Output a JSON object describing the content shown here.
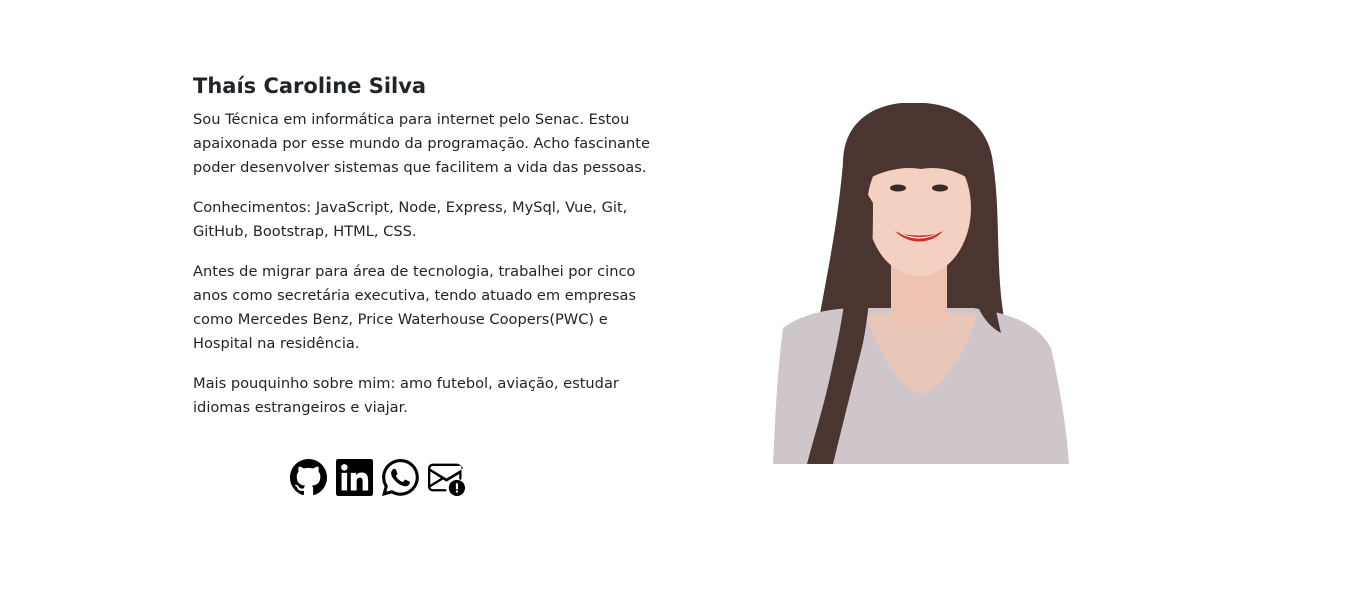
{
  "profile": {
    "name": "Thaís Caroline Silva",
    "paragraphs": [
      "Sou Técnica em informática para internet pelo Senac. Estou apaixonada por esse mundo da programação. Acho fascinante poder desenvolver sistemas que facilitem a vida das pessoas.",
      "Conhecimentos: JavaScript, Node, Express, MySql, Vue, Git, GitHub, Bootstrap, HTML, CSS.",
      "Antes de migrar para área de tecnologia, trabalhei por cinco anos como secretária executiva, tendo atuado em empresas como Mercedes Benz, Price Waterhouse Coopers(PWC) e Hospital na residência.",
      "Mais pouquinho sobre mim: amo futebol, aviação, estudar idiomas estrangeiros e viajar."
    ]
  },
  "socials": [
    {
      "icon": "github-icon"
    },
    {
      "icon": "linkedin-icon"
    },
    {
      "icon": "whatsapp-icon"
    },
    {
      "icon": "email-icon"
    }
  ],
  "photo": {
    "subject": "portrait-photo"
  },
  "colors": {
    "text": "#212529",
    "background": "#ffffff",
    "icon": "#000000"
  }
}
